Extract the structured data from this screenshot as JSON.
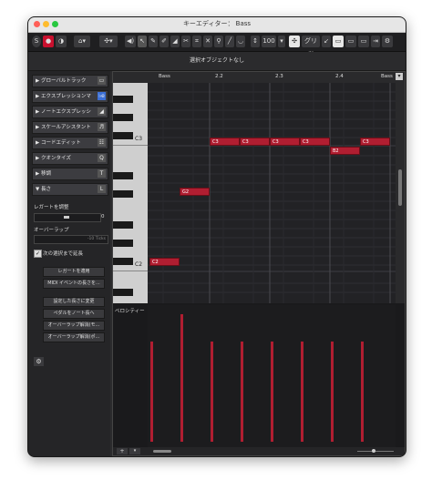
{
  "window": {
    "title": "キーエディター： Bass"
  },
  "toolbar": {
    "quantize_value": "100",
    "grid_label": "グリッ",
    "colors": {
      "active_red": "#c8102e"
    }
  },
  "info_line": {
    "text": "選択オブジェクトなし"
  },
  "inspector": {
    "sections": [
      {
        "label": "▶ グローバルトラック",
        "icon": "▭"
      },
      {
        "label": "▶ エクスプレッションマ",
        "icon": "♭e"
      },
      {
        "label": "▶ ノートエクスプレッシ",
        "icon": "◢"
      },
      {
        "label": "▶ スケールアシスタント",
        "icon": "♬"
      },
      {
        "label": "▶ コードエディット",
        "icon": "☷"
      },
      {
        "label": "▶ クオンタイズ",
        "icon": "Q"
      },
      {
        "label": "▶ 移調",
        "icon": "T"
      },
      {
        "label": "▼ 長さ",
        "icon": "L"
      }
    ],
    "legato_label": "レガートを調整",
    "legato_value": "0",
    "overlap_label": "オーバーラップ",
    "overlap_value": "-10 Ticks",
    "extend_label": "次の選択まで延長",
    "buttons": [
      "レガートを適用",
      "MIDI イベントの長さを...",
      "設定した長さに変更",
      "ペダルをノート長へ",
      "オーバーラップ解消(モ...",
      "オーバーラップ解消(ポ..."
    ]
  },
  "ruler": {
    "labels": [
      "Bass",
      "2.2",
      "2.3",
      "2.4",
      "Bass"
    ]
  },
  "keys": {
    "c3_label": "C3",
    "c2_label": "C2"
  },
  "notes": [
    {
      "label": "C3"
    },
    {
      "label": "C3"
    },
    {
      "label": "C3"
    },
    {
      "label": "C3"
    },
    {
      "label": "C3"
    },
    {
      "label": "B2"
    },
    {
      "label": "G2"
    },
    {
      "label": "C2"
    }
  ],
  "velocity": {
    "label": "ベロシティー"
  }
}
